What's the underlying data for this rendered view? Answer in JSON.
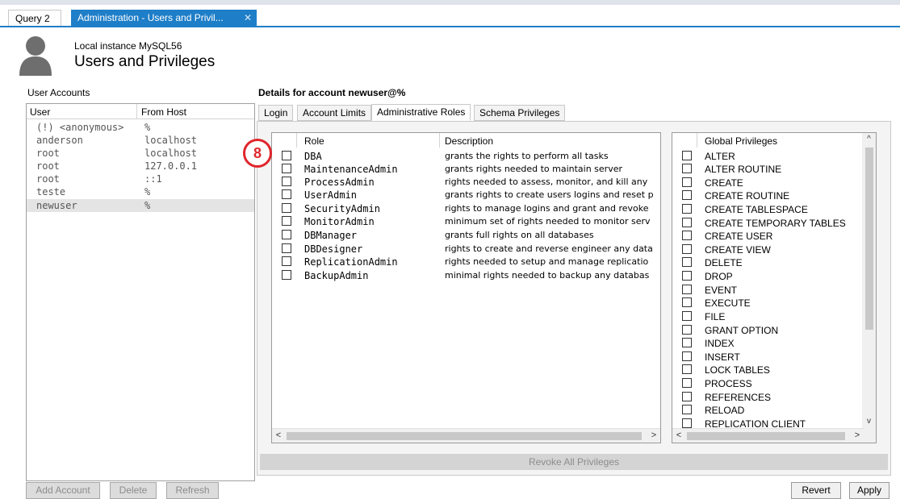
{
  "tabs": [
    {
      "label": "Query 2"
    },
    {
      "label": "Administration - Users and Privil..."
    }
  ],
  "header": {
    "subtitle": "Local instance MySQL56",
    "title": "Users and Privileges"
  },
  "user_accounts": {
    "label": "User Accounts",
    "columns": [
      "User",
      "From Host"
    ],
    "rows": [
      {
        "user": "(!) <anonymous>",
        "host": "%"
      },
      {
        "user": "anderson",
        "host": "localhost"
      },
      {
        "user": "root",
        "host": "localhost"
      },
      {
        "user": "root",
        "host": "127.0.0.1"
      },
      {
        "user": "root",
        "host": "::1"
      },
      {
        "user": "teste",
        "host": "%"
      },
      {
        "user": "newuser",
        "host": "%"
      }
    ],
    "buttons": {
      "add": "Add Account",
      "delete": "Delete",
      "refresh": "Refresh"
    }
  },
  "details": {
    "label": "Details for account newuser@%",
    "tabs": [
      "Login",
      "Account Limits",
      "Administrative Roles",
      "Schema Privileges"
    ],
    "roles_columns": [
      "Role",
      "Description"
    ],
    "roles": [
      {
        "role": "DBA",
        "desc": "grants the rights to perform all tasks"
      },
      {
        "role": "MaintenanceAdmin",
        "desc": "grants rights needed to maintain server"
      },
      {
        "role": "ProcessAdmin",
        "desc": "rights needed to assess, monitor, and kill any"
      },
      {
        "role": "UserAdmin",
        "desc": "grants rights to create users logins and reset p"
      },
      {
        "role": "SecurityAdmin",
        "desc": "rights to manage logins and grant and revoke"
      },
      {
        "role": "MonitorAdmin",
        "desc": "minimum set of rights needed to monitor serv"
      },
      {
        "role": "DBManager",
        "desc": "grants full rights on all databases"
      },
      {
        "role": "DBDesigner",
        "desc": "rights to create and reverse engineer any data"
      },
      {
        "role": "ReplicationAdmin",
        "desc": "rights needed to setup and manage replicatio"
      },
      {
        "role": "BackupAdmin",
        "desc": "minimal rights needed to backup any databas"
      }
    ],
    "privileges_column": "Global Privileges",
    "privileges": [
      "ALTER",
      "ALTER ROUTINE",
      "CREATE",
      "CREATE ROUTINE",
      "CREATE TABLESPACE",
      "CREATE TEMPORARY TABLES",
      "CREATE USER",
      "CREATE VIEW",
      "DELETE",
      "DROP",
      "EVENT",
      "EXECUTE",
      "FILE",
      "GRANT OPTION",
      "INDEX",
      "INSERT",
      "LOCK TABLES",
      "PROCESS",
      "REFERENCES",
      "RELOAD",
      "REPLICATION CLIENT"
    ],
    "revoke_label": "Revoke All Privileges"
  },
  "footer": {
    "revert": "Revert",
    "apply": "Apply"
  },
  "annotation": {
    "number": "8"
  },
  "colors": {
    "accent": "#1e7ec8",
    "annotation": "#e0262c"
  }
}
